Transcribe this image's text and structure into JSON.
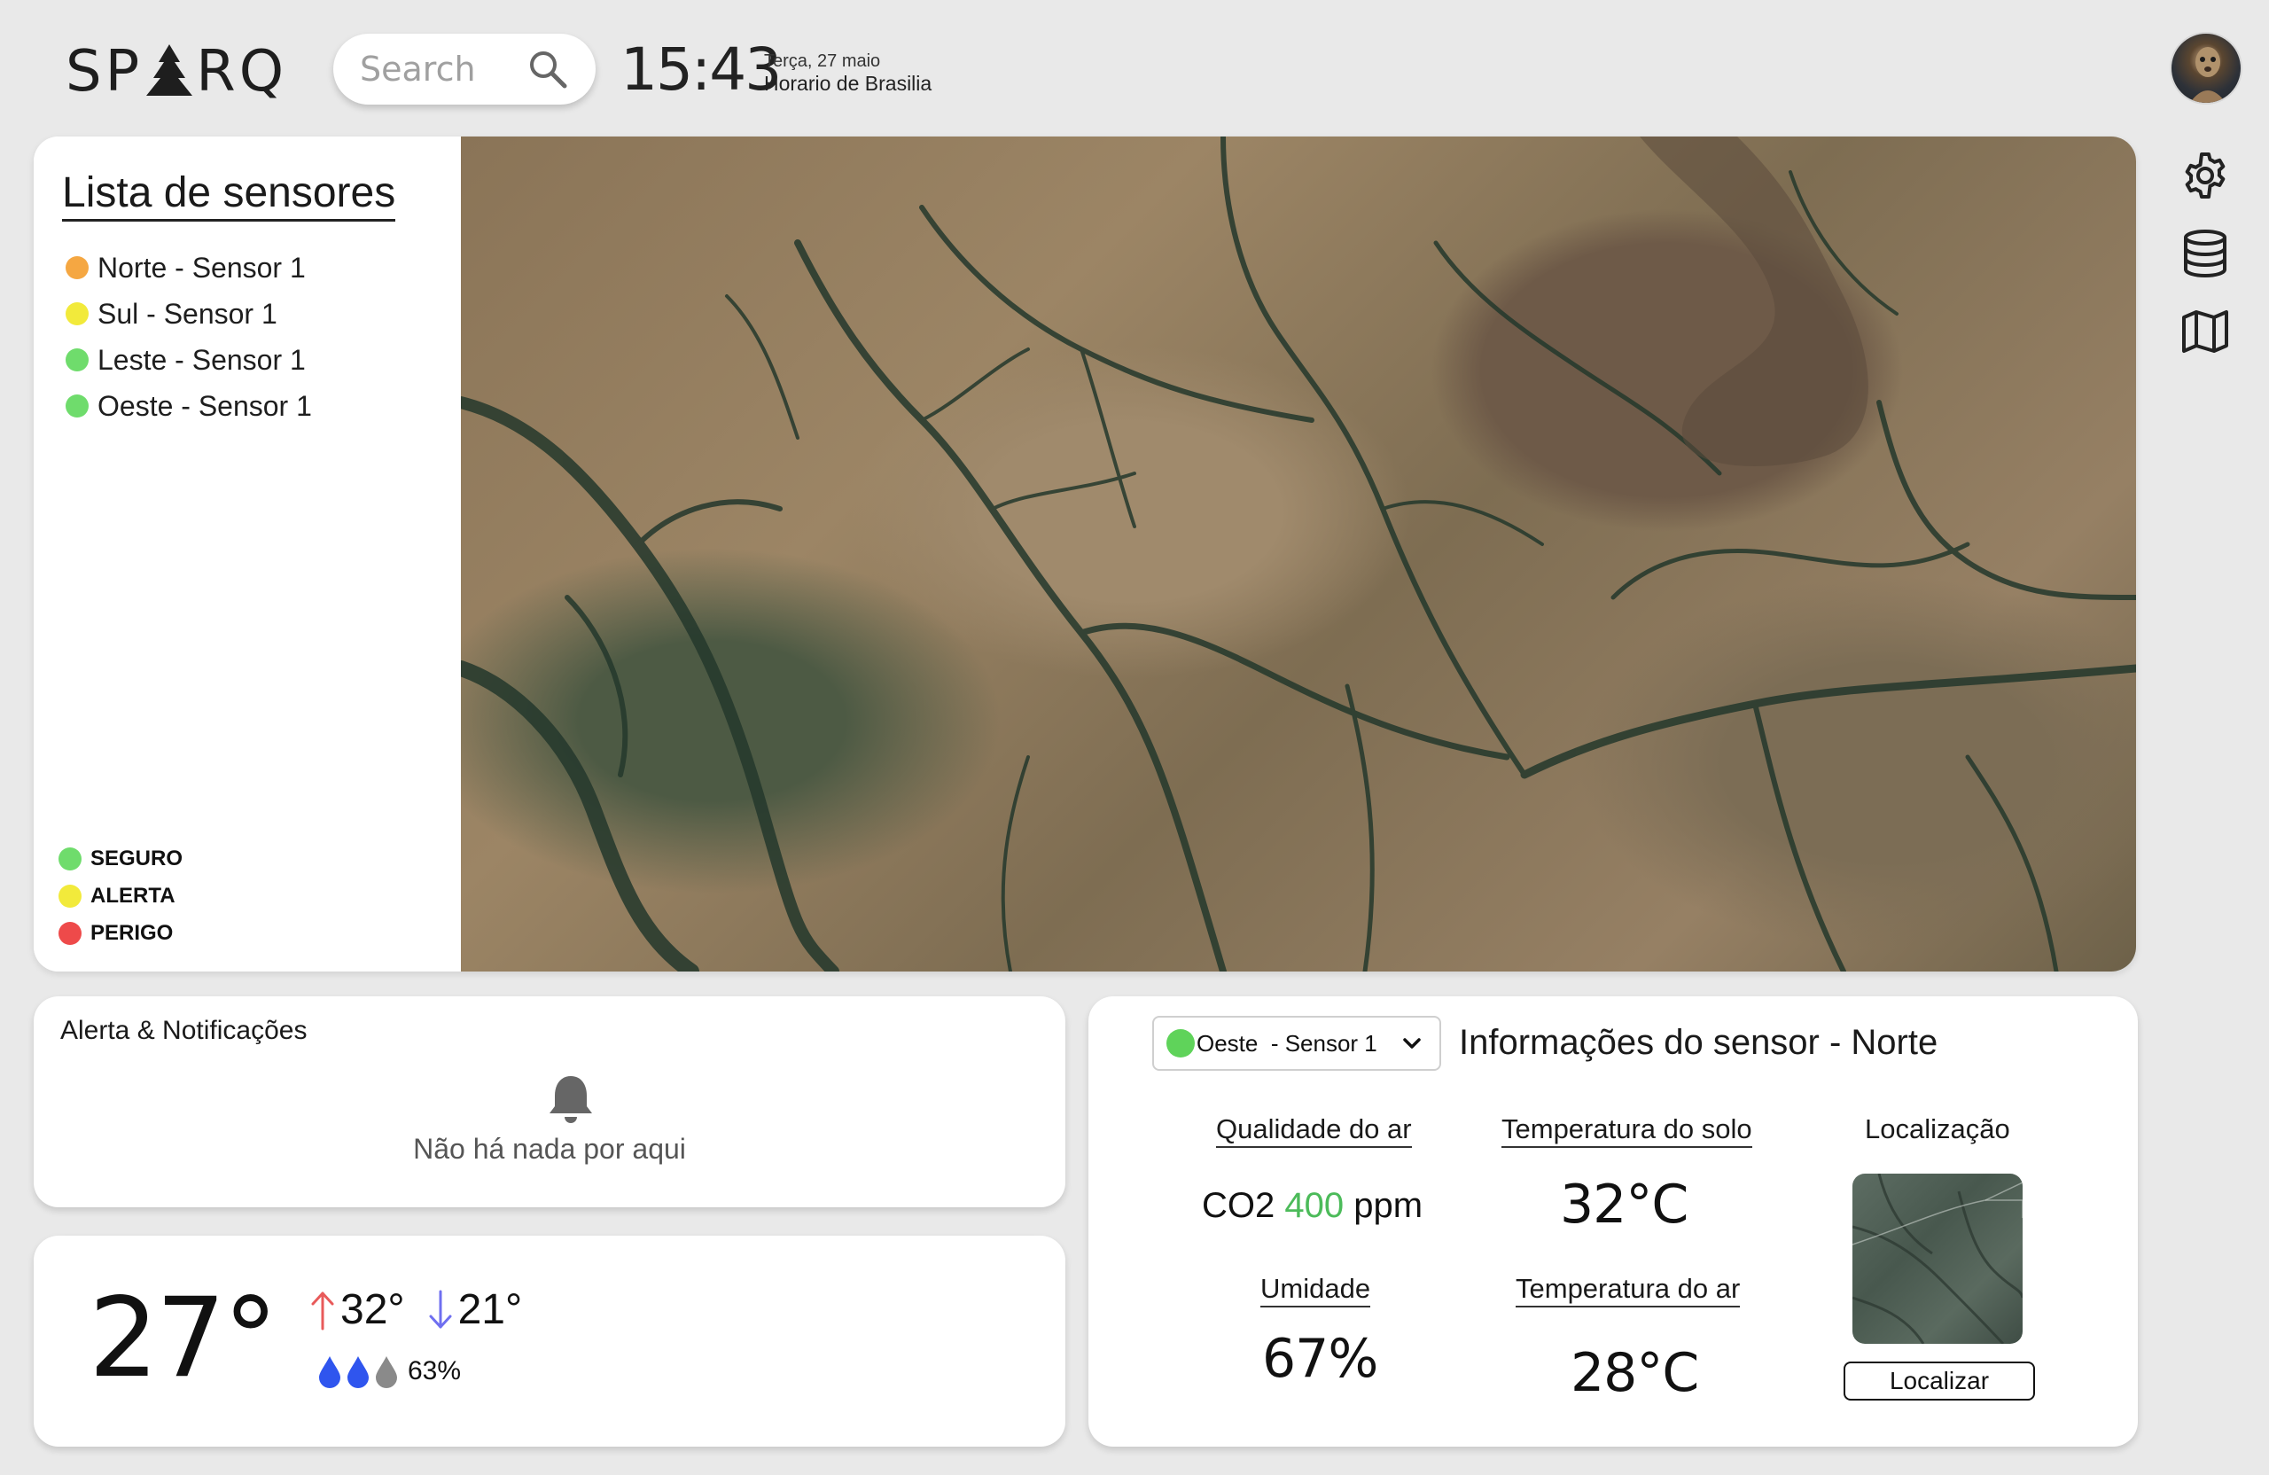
{
  "header": {
    "logo": "SPARQ",
    "search_placeholder": "Search",
    "time": "15:43",
    "date": "Terça, 27 maio",
    "timezone": "Horario de Brasilia"
  },
  "side_nav": {
    "icons": [
      "gear-icon",
      "database-icon",
      "map-icon"
    ]
  },
  "sensor_panel": {
    "title": "Lista de sensores",
    "sensors": [
      {
        "label": "Norte - Sensor 1",
        "status_color": "#f5a742"
      },
      {
        "label": "Sul - Sensor 1",
        "status_color": "#f2ea3b"
      },
      {
        "label": "Leste - Sensor 1",
        "status_color": "#6fdc6c"
      },
      {
        "label": "Oeste - Sensor 1",
        "status_color": "#6fdc6c"
      }
    ],
    "legend": [
      {
        "label": "SEGURO",
        "color": "#6fdc6c"
      },
      {
        "label": "ALERTA",
        "color": "#f2ea3b"
      },
      {
        "label": "PERIGO",
        "color": "#ee4a4a"
      }
    ]
  },
  "alerts": {
    "title": "Alerta & Notificações",
    "empty_message": "Não há nada por aqui"
  },
  "weather": {
    "current_temp": "27°",
    "high": "32°",
    "low": "21°",
    "humidity": "63%",
    "high_arrow_color": "#e85a5a",
    "low_arrow_color": "#6f6ff0",
    "drops": [
      "#2f55ee",
      "#2f55ee",
      "#8a8a8a"
    ]
  },
  "sensor_info": {
    "selected_sensor": "Oeste  - Sensor 1",
    "selected_color": "#5fd35a",
    "heading": "Informações do sensor - Norte",
    "air_quality": {
      "label": "Qualidade do ar",
      "prefix": "CO2",
      "value": "400",
      "unit": "ppm"
    },
    "soil_temp": {
      "label": "Temperatura do solo",
      "value": "32°C"
    },
    "humidity": {
      "label": "Umidade",
      "value": "67%"
    },
    "air_temp": {
      "label": "Temperatura do ar",
      "value": "28°C"
    },
    "location": {
      "label": "Localização",
      "button": "Localizar"
    }
  }
}
